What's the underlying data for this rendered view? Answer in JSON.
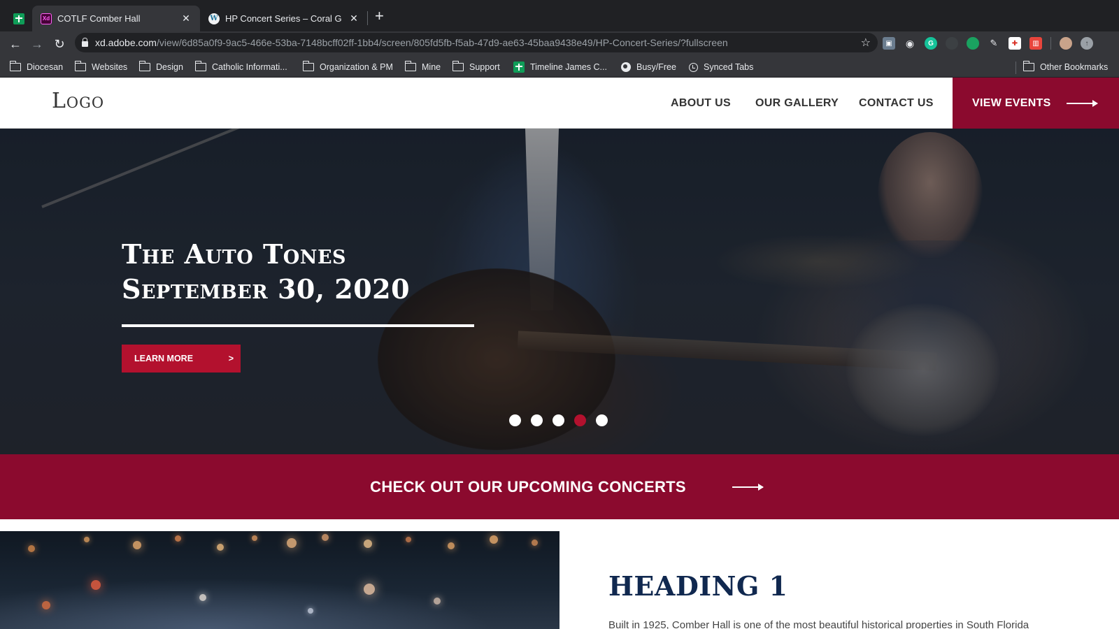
{
  "browser": {
    "tabs": [
      {
        "title": "COTLF Comber Hall",
        "favicon": "adobe-xd-icon",
        "active": true
      },
      {
        "title": "HP Concert Series – Coral Gabl",
        "favicon": "wordpress-icon",
        "active": false
      }
    ],
    "url": {
      "host": "xd.adobe.com",
      "path": "/view/6d85a0f9-9ac5-466e-53ba-7148bcff02ff-1bb4/screen/805fd5fb-f5ab-47d9-ae63-45baa9438e49/HP-Concert-Series/?fullscreen"
    },
    "bookmarks": [
      {
        "label": "Diocesan",
        "icon": "folder-icon"
      },
      {
        "label": "Websites",
        "icon": "folder-icon"
      },
      {
        "label": "Design",
        "icon": "folder-icon"
      },
      {
        "label": "Catholic Informati...",
        "icon": "folder-icon"
      },
      {
        "label": "Organization & PM",
        "icon": "folder-icon"
      },
      {
        "label": "Mine",
        "icon": "folder-icon"
      },
      {
        "label": "Support",
        "icon": "folder-icon"
      },
      {
        "label": "Timeline James C...",
        "icon": "sheets-icon"
      },
      {
        "label": "Busy/Free",
        "icon": "globe-icon"
      },
      {
        "label": "Synced Tabs",
        "icon": "history-icon"
      }
    ],
    "other_bookmarks": "Other Bookmarks"
  },
  "site": {
    "logo": "Logo",
    "nav": [
      "ABOUT US",
      "OUR GALLERY",
      "CONTACT US"
    ],
    "cta": "VIEW EVENTS",
    "hero": {
      "title_line1": "The Auto Tones",
      "title_line2": "September 30, 2020",
      "button": "LEARN MORE",
      "button_chevron": ">",
      "slide_count": 5,
      "active_slide": 4
    },
    "concerts_band": "CHECK OUT OUR UPCOMING CONCERTS",
    "heading1": "HEADING 1",
    "body_text": "Built in 1925, Comber Hall is one of the most beautiful historical properties in South Florida"
  },
  "colors": {
    "brand": "#8b0a2e",
    "button": "#b3112e",
    "heading": "#10284f",
    "chrome_dark": "#202124",
    "chrome_toolbar": "#35363a"
  }
}
